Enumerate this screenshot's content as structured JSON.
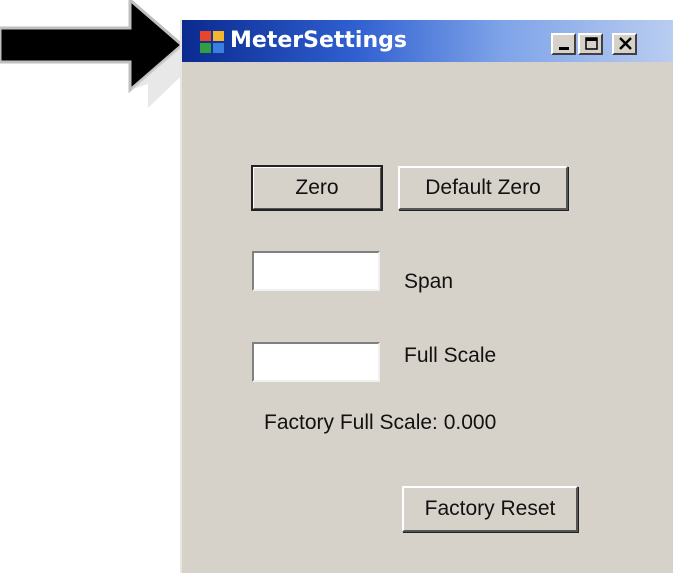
{
  "window": {
    "title": "MeterSettings",
    "controls": {
      "minimize": "minimize",
      "maximize": "maximize",
      "close": "close"
    }
  },
  "buttons": {
    "zero": "Zero",
    "default_zero": "Default Zero",
    "factory_reset": "Factory Reset"
  },
  "fields": {
    "span": {
      "label": "Span",
      "value": ""
    },
    "full_scale": {
      "label": "Full Scale",
      "value": ""
    }
  },
  "factory_full_scale": {
    "label": "Factory Full Scale:",
    "value": "0.000",
    "text": "Factory Full Scale:  0.000"
  },
  "colors": {
    "window_bg": "#d6d2ca",
    "titlebar_start": "#0a2a8f",
    "titlebar_end": "#b9cdf0",
    "arrow": "#000000"
  },
  "icons": [
    "arrow-pointer-icon",
    "app-icon",
    "minimize-icon",
    "maximize-icon",
    "close-icon"
  ]
}
